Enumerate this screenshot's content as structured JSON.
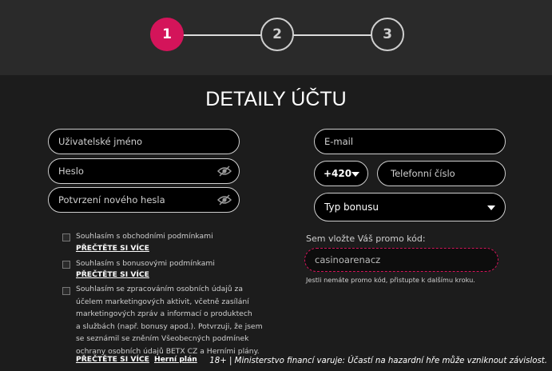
{
  "stepper": {
    "steps": [
      "1",
      "2",
      "3"
    ],
    "active_step": 1
  },
  "page_title": "DETAILY ÚČTU",
  "form": {
    "username_placeholder": "Uživatelské jméno",
    "password_placeholder": "Heslo",
    "password_confirm_placeholder": "Potvrzení nového hesla",
    "email_placeholder": "E-mail",
    "country_code": "+420",
    "phone_placeholder": "Telefonní číslo",
    "bonus_type": "Typ bonusu",
    "promo_label": "Sem vložte Váš promo kód:",
    "promo_value": "casinoarenacz",
    "promo_hint": "Jestli nemáte promo kód, přistupte k dalšímu kroku."
  },
  "consents": {
    "terms": {
      "text": "Souhlasím s obchodními podmínkami",
      "link": "PŘEČTĚTE SI VÍCE"
    },
    "bonus": {
      "text": "Souhlasím s bonusovými podmínkami",
      "link": "PŘEČTĚTE SI VÍCE"
    },
    "marketing": {
      "lines": [
        "Souhlasím se zpracováním osobních údajů za",
        "účelem marketingových aktivit, včetně zasílání",
        "marketingových zpráv a informací o produktech",
        "a službách (např. bonusy apod.). Potvrzuji, že jsem",
        "se seznámil se zněním Všeobecných podmínek",
        "ochrany osobních údajů BETX CZ a Herními plány."
      ],
      "link": "PŘEČTĚTE SI VÍCE",
      "link2": "Herní plán"
    }
  },
  "footer_warning": "18+ | Ministerstvo financí varuje: Účastí na hazardní hře může vzniknout závislost.",
  "colors": {
    "accent": "#d4145a",
    "background": "#1c1c1c",
    "stepper_bg": "#2a2a2a"
  }
}
